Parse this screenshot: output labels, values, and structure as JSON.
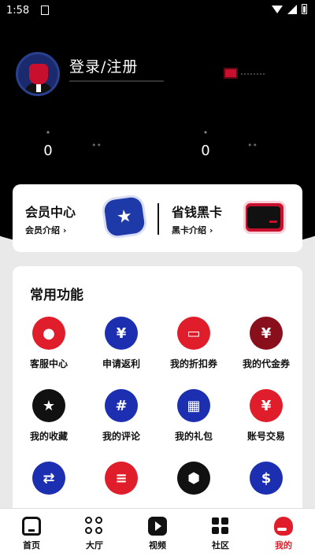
{
  "status_bar": {
    "time": "1:58"
  },
  "profile": {
    "login_text": "登录/注册"
  },
  "stats": [
    {
      "value": "0"
    },
    {
      "value": "0"
    }
  ],
  "member_card": {
    "left": {
      "title": "会员中心",
      "subtitle": "会员介绍"
    },
    "right": {
      "title": "省钱黑卡",
      "subtitle": "黑卡介绍"
    }
  },
  "functions": {
    "title": "常用功能",
    "items": [
      {
        "label": "客服中心",
        "icon": "customer-service-icon",
        "color": "#e01e2b"
      },
      {
        "label": "申请返利",
        "icon": "rebate-icon",
        "color": "#1b2fb0"
      },
      {
        "label": "我的折扣券",
        "icon": "discount-coupon-icon",
        "color": "#e01e2b"
      },
      {
        "label": "我的代金券",
        "icon": "voucher-icon",
        "color": "#8a0f1c"
      },
      {
        "label": "我的收藏",
        "icon": "star-icon",
        "color": "#111111"
      },
      {
        "label": "我的评论",
        "icon": "comment-icon",
        "color": "#1b2fb0"
      },
      {
        "label": "我的礼包",
        "icon": "gift-icon",
        "color": "#1b2fb0"
      },
      {
        "label": "账号交易",
        "icon": "money-bag-icon",
        "color": "#e01e2b"
      },
      {
        "label": "",
        "icon": "transfer-icon",
        "color": "#1b2fb0"
      },
      {
        "label": "",
        "icon": "coin-stack-icon",
        "color": "#e01e2b"
      },
      {
        "label": "",
        "icon": "settings-icon",
        "color": "#111111"
      },
      {
        "label": "",
        "icon": "coins-icon",
        "color": "#1b2fb0"
      }
    ]
  },
  "tabbar": {
    "tabs": [
      {
        "label": "首页",
        "icon": "home-icon"
      },
      {
        "label": "大厅",
        "icon": "hall-icon"
      },
      {
        "label": "视频",
        "icon": "video-icon"
      },
      {
        "label": "社区",
        "icon": "community-icon"
      },
      {
        "label": "我的",
        "icon": "me-icon",
        "active": true
      }
    ]
  }
}
